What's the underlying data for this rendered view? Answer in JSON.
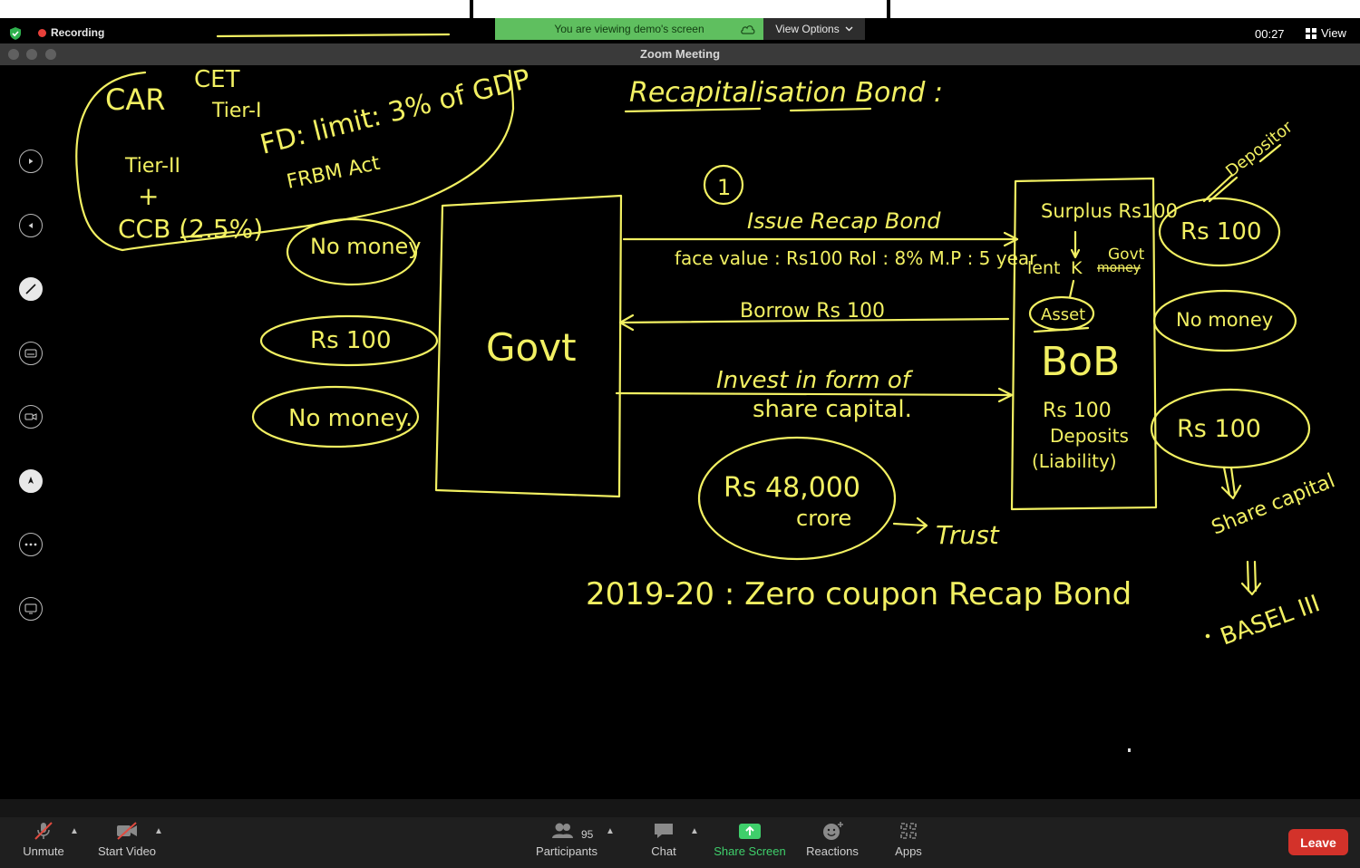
{
  "status": {
    "recording_label": "Recording",
    "banner_text": "You are viewing demo's screen",
    "view_options_label": "View Options",
    "timer": "00:27",
    "view_label": "View",
    "window_title": "Zoom Meeting"
  },
  "controls": {
    "unmute_label": "Unmute",
    "start_video_label": "Start Video",
    "participants_label": "Participants",
    "participants_count": "95",
    "chat_label": "Chat",
    "share_screen_label": "Share Screen",
    "reactions_label": "Reactions",
    "apps_label": "Apps",
    "leave_label": "Leave"
  },
  "colors": {
    "ink": "#f2f062",
    "banner": "#5fbf5f",
    "leave": "#d3322a",
    "share_green": "#3fcf6b"
  },
  "annotation_tools": [
    "play-next-icon",
    "play-prev-icon",
    "pen-tool-icon",
    "caption-icon",
    "camera-icon",
    "compass-icon",
    "more-icon",
    "screen-share-icon"
  ],
  "whiteboard": {
    "heading": "Recapitalisation Bond :",
    "top_left": {
      "car": "CAR",
      "tier1": "Tier-I",
      "tier2": "Tier-II",
      "ccb": "CCB (2.5%)",
      "fd_limit": "FD: limit: 3% of GDP",
      "frbm": "FRBM Act",
      "cet": "CET"
    },
    "step_number": "1",
    "arrow1_label": "Issue Recap Bond",
    "face_value": "face value : Rs100  RoI : 8%   M.P : 5 year",
    "arrow2_label": "Borrow Rs 100",
    "arrow3_line1": "Invest in form of",
    "arrow3_line2": "share capital.",
    "govt_box": "Govt",
    "left_ovals": [
      "No money",
      "Rs 100",
      "No money."
    ],
    "bank_box": {
      "surplus": "Surplus Rs100",
      "lent": "lent",
      "k": "K",
      "govt": "Govt",
      "money_struck": "money",
      "asset": "Asset",
      "name": "BoB",
      "deposits_amount": "Rs 100",
      "deposits": "Deposits",
      "liability": "(Liability)"
    },
    "right_ovals": [
      "Rs 100",
      "No money",
      "Rs 100"
    ],
    "depositor": "Depositor",
    "share_capital": "Share capital",
    "basel": "BASEL III",
    "crore_amount": "Rs 48,000",
    "crore_unit": "crore",
    "trust": "Trust",
    "bottom_line": "2019-20 : Zero coupon Recap Bond"
  }
}
